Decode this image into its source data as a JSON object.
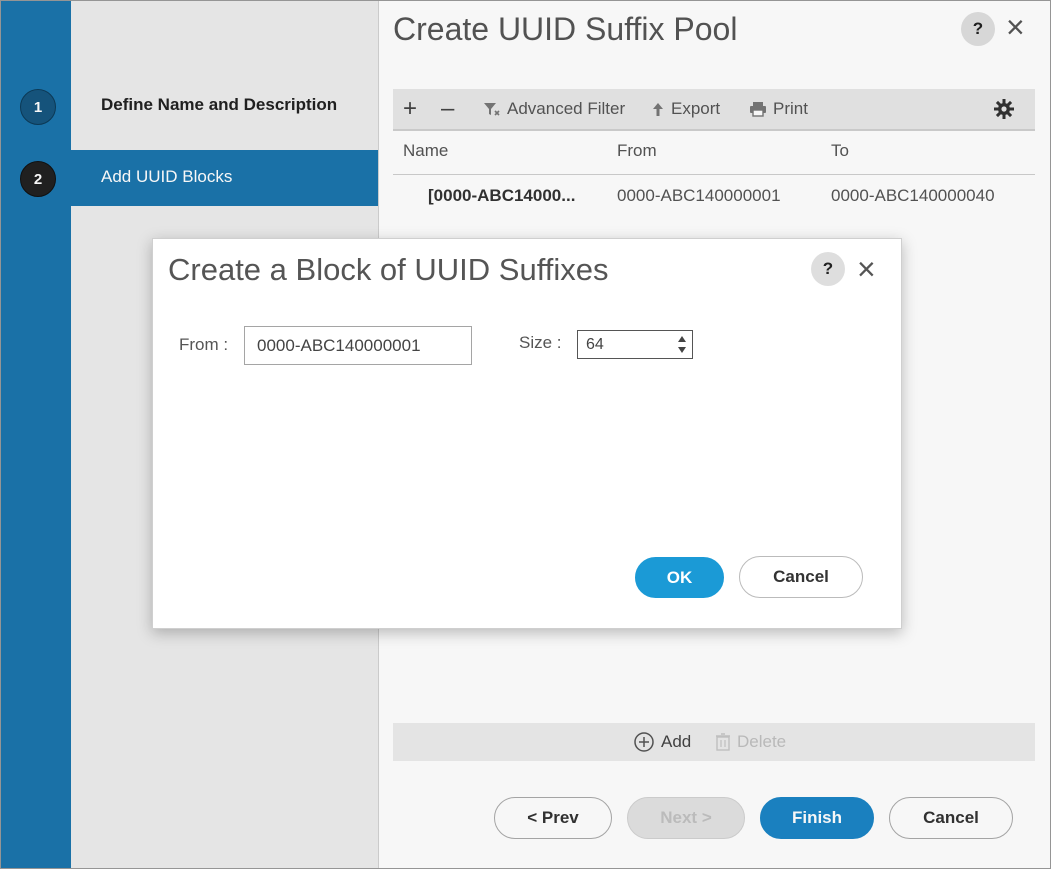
{
  "wizard": {
    "steps": [
      {
        "number": "1",
        "label": "Define Name and Description"
      },
      {
        "number": "2",
        "label": "Add UUID Blocks"
      }
    ]
  },
  "main": {
    "title": "Create UUID Suffix Pool",
    "help": "?",
    "close": "×",
    "toolbar": {
      "add": "+",
      "remove": "–",
      "filter": "Advanced Filter",
      "export": "Export",
      "print": "Print"
    },
    "table": {
      "columns": [
        "Name",
        "From",
        "To"
      ],
      "rows": [
        {
          "name": "[0000-ABC14000...",
          "from": "0000-ABC140000001",
          "to": "0000-ABC140000040"
        }
      ]
    },
    "bottom_bar": {
      "add": "Add",
      "delete": "Delete"
    },
    "buttons": {
      "prev": "< Prev",
      "next": "Next >",
      "finish": "Finish",
      "cancel": "Cancel"
    }
  },
  "dialog": {
    "title": "Create a Block of UUID Suffixes",
    "help": "?",
    "close": "×",
    "from_label": "From :",
    "from_value": "0000-ABC140000001",
    "size_label": "Size :",
    "size_value": "64",
    "ok": "OK",
    "cancel": "Cancel"
  },
  "colors": {
    "wizard_blue": "#1b75ad",
    "primary_button": "#1b85c6",
    "ok_button": "#1b9ad6"
  }
}
